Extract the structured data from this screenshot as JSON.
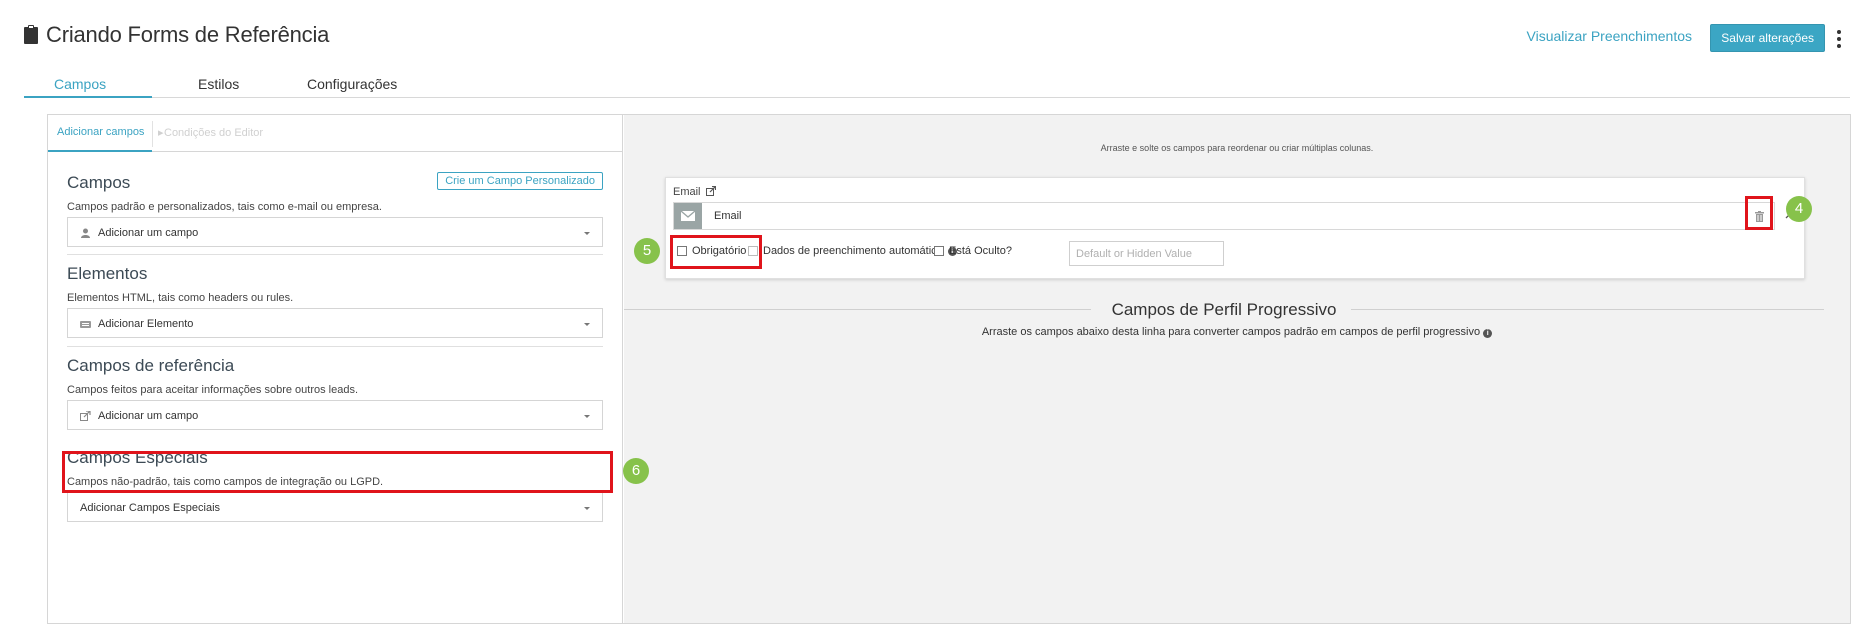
{
  "header": {
    "title": "Criando Forms de Referência",
    "view_link": "Visualizar Preenchimentos",
    "save_label": "Salvar alterações"
  },
  "tabs": [
    {
      "label": "Campos",
      "active": true
    },
    {
      "label": "Estilos",
      "active": false
    },
    {
      "label": "Configurações",
      "active": false
    }
  ],
  "left_panel": {
    "subtabs": [
      {
        "label": "Adicionar campos",
        "active": true
      },
      {
        "label": "Condições do Editor",
        "active": false
      }
    ],
    "sections": [
      {
        "title": "Campos",
        "description": "Campos padrão e personalizados, tais como e-mail ou empresa.",
        "dropdown": "Adicionar um campo",
        "icon": "user-icon",
        "button": "Crie um Campo Personalizado"
      },
      {
        "title": "Elementos",
        "description": "Elementos HTML, tais como headers ou rules.",
        "dropdown": "Adicionar Elemento",
        "icon": "keyboard-icon"
      },
      {
        "title": "Campos de referência",
        "description": "Campos feitos para aceitar informações sobre outros leads.",
        "dropdown": "Adicionar um campo",
        "icon": "share-icon"
      },
      {
        "title": "Campos Especiais",
        "description": "Campos não-padrão, tais como campos de integração ou LGPD.",
        "dropdown": "Adicionar Campos Especiais"
      }
    ]
  },
  "right_panel": {
    "drag_hint": "Arraste e solte os campos para reordenar ou criar múltiplas colunas.",
    "field": {
      "name": "Email",
      "input_label": "Email",
      "options": {
        "required": "Obrigatório",
        "autofill": "Dados de preenchimento automático",
        "hidden": "Está Oculto?",
        "hidden_placeholder": "Default or Hidden Value"
      }
    },
    "progressive": {
      "title": "Campos de Perfil Progressivo",
      "description": "Arraste os campos abaixo desta linha para converter campos padrão em campos de perfil progressivo"
    }
  },
  "annotations": {
    "badge_4": "4",
    "badge_5": "5",
    "badge_6": "6",
    "highlight_color": "#e0141b",
    "badge_color": "#87c24b"
  },
  "colors": {
    "accent": "#3ba3c2",
    "save_button": "#3ba6c4"
  }
}
